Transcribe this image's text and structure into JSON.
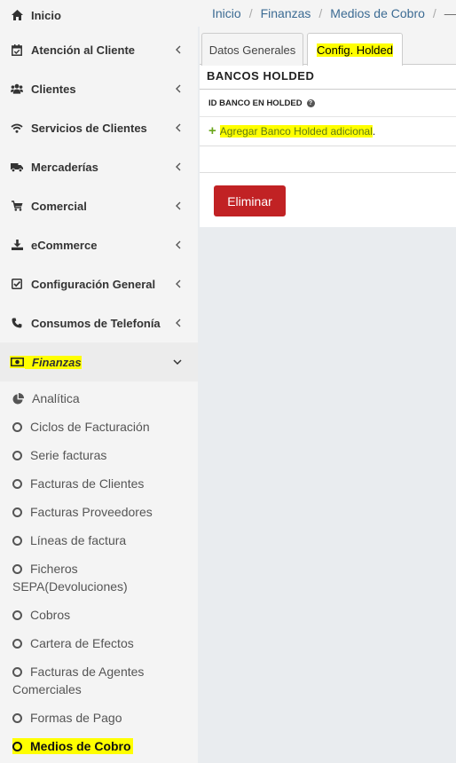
{
  "sidebar": {
    "items": [
      {
        "label": "Inicio",
        "icon": "home-icon"
      },
      {
        "label": "Atención al Cliente",
        "icon": "calendar-check-icon"
      },
      {
        "label": "Clientes",
        "icon": "users-icon"
      },
      {
        "label": "Servicios de Clientes",
        "icon": "wifi-icon"
      },
      {
        "label": "Mercaderías",
        "icon": "truck-icon"
      },
      {
        "label": "Comercial",
        "icon": "cart-icon"
      },
      {
        "label": "eCommerce",
        "icon": "download-icon"
      },
      {
        "label": "Configuración General",
        "icon": "check-square-icon"
      },
      {
        "label": "Consumos de Telefonía",
        "icon": "phone-icon"
      },
      {
        "label": "Finanzas",
        "icon": "money-bill-icon"
      }
    ],
    "sub_items": [
      {
        "label": "Analítica",
        "icon": "pie-chart-icon"
      },
      {
        "label": "Ciclos de Facturación",
        "icon": "circle-icon"
      },
      {
        "label": "Serie facturas",
        "icon": "circle-icon"
      },
      {
        "label": "Facturas de Clientes",
        "icon": "circle-icon"
      },
      {
        "label": "Facturas Proveedores",
        "icon": "circle-icon"
      },
      {
        "label": "Líneas de factura",
        "icon": "circle-icon"
      },
      {
        "label": "Ficheros SEPA(Devoluciones)",
        "icon": "circle-icon"
      },
      {
        "label": "Cobros",
        "icon": "circle-icon"
      },
      {
        "label": "Cartera de Efectos",
        "icon": "circle-icon"
      },
      {
        "label": "Facturas de Agentes Comerciales",
        "icon": "circle-icon"
      },
      {
        "label": "Formas de Pago",
        "icon": "circle-icon"
      },
      {
        "label": "Medios de Cobro",
        "icon": "circle-icon"
      }
    ]
  },
  "breadcrumb": {
    "items": [
      "Inicio",
      "Finanzas",
      "Medios de Cobro"
    ],
    "separator": "/",
    "trailing": "—"
  },
  "tabs": [
    {
      "label": "Datos Generales",
      "active": false
    },
    {
      "label": "Config. Holded",
      "active": true
    }
  ],
  "panel": {
    "title": "BANCOS HOLDED",
    "column_header": "ID BANCO EN HOLDED",
    "help_icon": "?",
    "add_plus": "+",
    "add_link": "Agregar Banco Holded adicional",
    "add_suffix": "."
  },
  "actions": {
    "delete_label": "Eliminar"
  },
  "colors": {
    "highlight": "#ffff00",
    "delete": "#c12224",
    "link": "#3c6b93",
    "plus": "#6aa61b"
  }
}
